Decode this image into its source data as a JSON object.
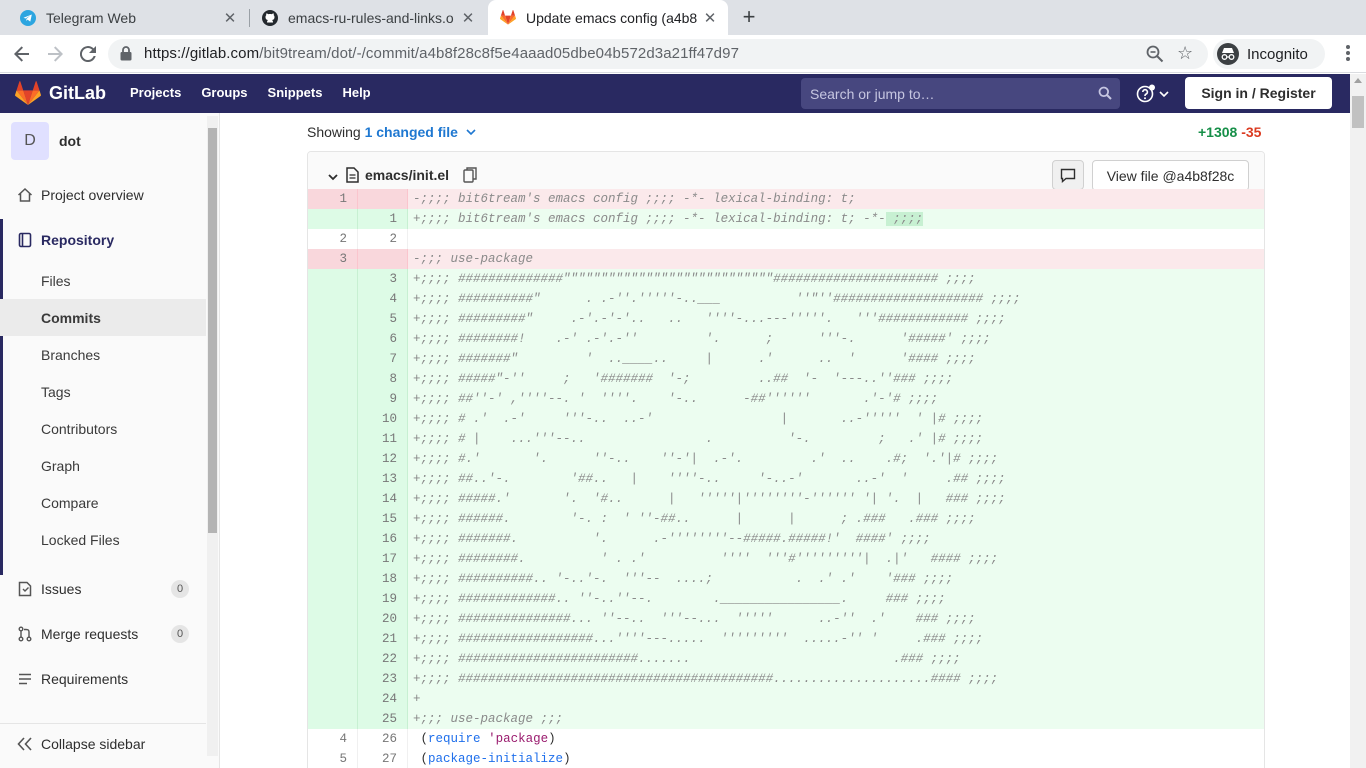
{
  "browser": {
    "tabs": [
      {
        "title": "Telegram Web",
        "icon": "telegram-icon"
      },
      {
        "title": "emacs-ru-rules-and-links.o",
        "icon": "github-icon"
      },
      {
        "title": "Update emacs config (a4b8",
        "icon": "gitlab-icon"
      }
    ],
    "url_host": "https://gitlab.com",
    "url_path": "/bit9tream/dot/-/commit/a4b8f28c8f5e4aaad05dbe04b572d3a21ff47d97",
    "profile_label": "Incognito"
  },
  "gitlab": {
    "logo_text": "GitLab",
    "nav": [
      "Projects",
      "Groups",
      "Snippets",
      "Help"
    ],
    "search_placeholder": "Search or jump to…",
    "signin_label": "Sign in / Register",
    "brand_color": "#292961"
  },
  "sidebar": {
    "project_initial": "D",
    "project_name": "dot",
    "overview": "Project overview",
    "repository": "Repository",
    "repo_items": [
      "Files",
      "Commits",
      "Branches",
      "Tags",
      "Contributors",
      "Graph",
      "Compare",
      "Locked Files"
    ],
    "issues": {
      "label": "Issues",
      "count": "0"
    },
    "merge_requests": {
      "label": "Merge requests",
      "count": "0"
    },
    "requirements": "Requirements",
    "collapse": "Collapse sidebar"
  },
  "commit": {
    "showing_prefix": "Showing",
    "changed_files": "1 changed file",
    "additions": "+1308",
    "deletions": "-35"
  },
  "file": {
    "name": "emacs/init.el",
    "view_file_label": "View file @a4b8f28c",
    "lines": [
      {
        "t": "del",
        "o": "1",
        "n": "",
        "text": ";;;; bit6tream's emacs config ;;;; -*- lexical-binding: t;"
      },
      {
        "t": "add",
        "o": "",
        "n": "1",
        "text": ";;;; bit6tream's emacs config ;;;; -*- lexical-binding: t; -*-",
        "hl": " ;;;;"
      },
      {
        "t": "ctx",
        "o": "2",
        "n": "2",
        "text": ""
      },
      {
        "t": "del",
        "o": "3",
        "n": "",
        "text": ";;; use-package"
      },
      {
        "t": "add",
        "o": "",
        "n": "3",
        "text": ";;;; ##############\"\"\"\"\"\"\"\"\"\"\"\"\"\"\"\"\"\"\"\"\"\"\"\"\"\"\"\"###################### ;;;;"
      },
      {
        "t": "add",
        "o": "",
        "n": "4",
        "text": ";;;; ##########\"      . .-''.'''''-..___          ''\"''#################### ;;;;"
      },
      {
        "t": "add",
        "o": "",
        "n": "5",
        "text": ";;;; #########\"     .-'.-'-'..   ..   ''''-...---'''''.   '''############ ;;;;"
      },
      {
        "t": "add",
        "o": "",
        "n": "6",
        "text": ";;;; ########!    .-' .-'.-''         '.      ;      '''-.      '#####' ;;;;"
      },
      {
        "t": "add",
        "o": "",
        "n": "7",
        "text": ";;;; #######\"         '  ..____..     |      .'      ..  '      '#### ;;;;"
      },
      {
        "t": "add",
        "o": "",
        "n": "8",
        "text": ";;;; #####\"-''     ;   '#######  '-;         ..##  '-  '---..''### ;;;;"
      },
      {
        "t": "add",
        "o": "",
        "n": "9",
        "text": ";;;; ##''-' ,''''--. '  ''''.    '-..      -##''''''       .'-'# ;;;;"
      },
      {
        "t": "add",
        "o": "",
        "n": "10",
        "text": ";;;; # .'  .-'     '''-..  ..-'                 |       ..-'''''  ' |# ;;;;"
      },
      {
        "t": "add",
        "o": "",
        "n": "11",
        "text": ";;;; # |    ...'''--..                .          '-.         ;   .' |# ;;;;"
      },
      {
        "t": "add",
        "o": "",
        "n": "12",
        "text": ";;;; #.'       '.      ''-..    ''-'|  .-'.         .'  ..    .#;  '.'|# ;;;;"
      },
      {
        "t": "add",
        "o": "",
        "n": "13",
        "text": ";;;; ##..'-.        '##..   |    ''''-..     '-..-'       ..-'  '     .## ;;;;"
      },
      {
        "t": "add",
        "o": "",
        "n": "14",
        "text": ";;;; #####.'       '.  '#..      |   '''''|''''''''-'''''' '| '.  |   ### ;;;;"
      },
      {
        "t": "add",
        "o": "",
        "n": "15",
        "text": ";;;; ######.        '-. :  ' ''-##..      |      |      ; .###   .### ;;;;"
      },
      {
        "t": "add",
        "o": "",
        "n": "16",
        "text": ";;;; #######.          '.      .-''''''''--#####.#####!'  ####' ;;;;"
      },
      {
        "t": "add",
        "o": "",
        "n": "17",
        "text": ";;;; ########.          ' . .'          ''''  '''#'''''''''|  .|'   #### ;;;;"
      },
      {
        "t": "add",
        "o": "",
        "n": "18",
        "text": ";;;; ##########.. '-..'-.  '''--  ....;           .  .' .'    '### ;;;;"
      },
      {
        "t": "add",
        "o": "",
        "n": "19",
        "text": ";;;; #############.. ''-..''--.        .________________.     ### ;;;;"
      },
      {
        "t": "add",
        "o": "",
        "n": "20",
        "text": ";;;; ###############... ''--..  '''--...  '''''      ..-''  .'    ### ;;;;"
      },
      {
        "t": "add",
        "o": "",
        "n": "21",
        "text": ";;;; ##################...''''---.....  '''''''''  .....-'' '     .### ;;;;"
      },
      {
        "t": "add",
        "o": "",
        "n": "22",
        "text": ";;;; ########################.......                           .### ;;;;"
      },
      {
        "t": "add",
        "o": "",
        "n": "23",
        "text": ";;;; ##########################################.....................#### ;;;;"
      },
      {
        "t": "add",
        "o": "",
        "n": "24",
        "text": ""
      },
      {
        "t": "add",
        "o": "",
        "n": "25",
        "text": ";;; use-package ;;;"
      },
      {
        "t": "ctx",
        "o": "4",
        "n": "26",
        "text": "",
        "code": [
          [
            "(",
            ""
          ],
          [
            "require",
            "kw"
          ],
          [
            " ",
            ""
          ],
          [
            "'package",
            "sym"
          ],
          [
            ")",
            ""
          ]
        ]
      },
      {
        "t": "ctx",
        "o": "5",
        "n": "27",
        "text": "",
        "code": [
          [
            "(",
            ""
          ],
          [
            "package-initialize",
            "kw"
          ],
          [
            ")",
            ""
          ]
        ]
      }
    ]
  }
}
